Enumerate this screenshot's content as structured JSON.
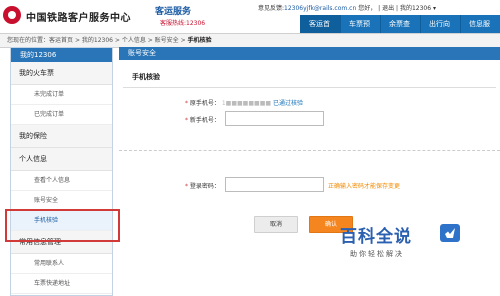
{
  "header": {
    "title": "中国铁路客户服务中心",
    "subtitle": "客运服务",
    "hotline": "客服热线:12306",
    "toplinks": {
      "feedback_label": "意见反馈:",
      "email": "12306yjfk@rails.com.cn",
      "greeting": "您好，",
      "logout": "退出",
      "my12306": "我的12306"
    },
    "nav": [
      "客运首页",
      "车票预订",
      "余票查询",
      "出行向导",
      "信息服务"
    ]
  },
  "breadcrumb": {
    "prefix": "您现在的位置：",
    "items": [
      "客运首页",
      "我的12306",
      "个人信息",
      "账号安全"
    ],
    "current": "手机核验"
  },
  "sidebar": {
    "title": "我的12306",
    "sections": [
      {
        "label": "我的火车票",
        "items": [
          "未完成订单",
          "已完成订单"
        ]
      },
      {
        "label": "我的保险",
        "items": []
      },
      {
        "label": "个人信息",
        "items": [
          "查看个人信息",
          "账号安全",
          "手机核验"
        ]
      },
      {
        "label": "常用信息管理",
        "items": [
          "常用联系人",
          "车票快递地址"
        ]
      }
    ]
  },
  "main": {
    "header": "账号安全",
    "panel_title": "手机核验",
    "original_phone_label": "原手机号：",
    "original_phone_value": "1■■■■■■■■",
    "verified_text": "已通过核验",
    "new_phone_label": "新手机号：",
    "new_phone_value": "",
    "password_label": "登录密码：",
    "password_value": "",
    "password_hint": "正确输入密码才能保存变更",
    "cancel_label": "取消",
    "confirm_label": "确认"
  },
  "watermark": {
    "title": "百科全说",
    "subtitle": "助你轻松解决"
  }
}
